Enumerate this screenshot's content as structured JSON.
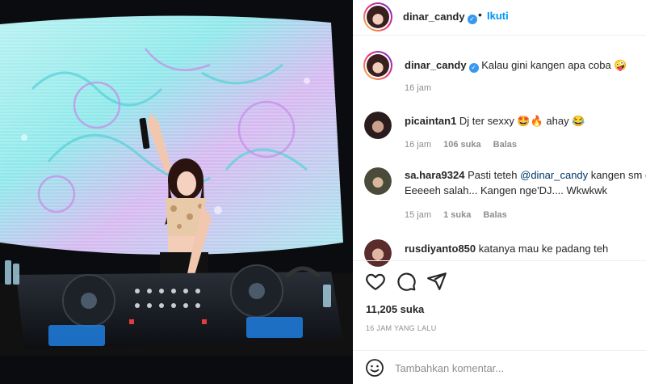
{
  "post": {
    "username": "dinar_candy",
    "verified_icon": "verified-badge-icon",
    "dot": "•",
    "follow_label": "Ikuti"
  },
  "caption": {
    "username": "dinar_candy",
    "text": "Kalau gini kangen apa coba 🤪",
    "time": "16 jam"
  },
  "comments": [
    {
      "username": "picaintan1",
      "text": "Dj ter sexxy 🤩🔥 ahay 😂",
      "time": "16 jam",
      "likes": "106 suka",
      "reply": "Balas"
    },
    {
      "username": "sa.hara9324",
      "text_before": "Pasti teteh ",
      "mention": "@dinar_candy",
      "text_after": " kangen sm e",
      "line2": "Eeeeeh salah... Kangen nge'DJ.... Wkwkwk",
      "time": "15 jam",
      "likes": "1 suka",
      "reply": "Balas"
    },
    {
      "username": "rusdiyanto850",
      "text": "katanya mau ke padang teh"
    }
  ],
  "actions": {
    "like_icon": "heart-icon",
    "comment_icon": "comment-icon",
    "share_icon": "share-icon",
    "likes": "11,205 suka",
    "time_ago": "16 JAM YANG LALU"
  },
  "add_comment": {
    "emoji_icon": "emoji-icon",
    "placeholder": "Tambahkan komentar..."
  },
  "colors": {
    "link_blue": "#0095f6",
    "text": "#262626",
    "muted": "#8e8e8e",
    "verified": "#3897f0"
  }
}
